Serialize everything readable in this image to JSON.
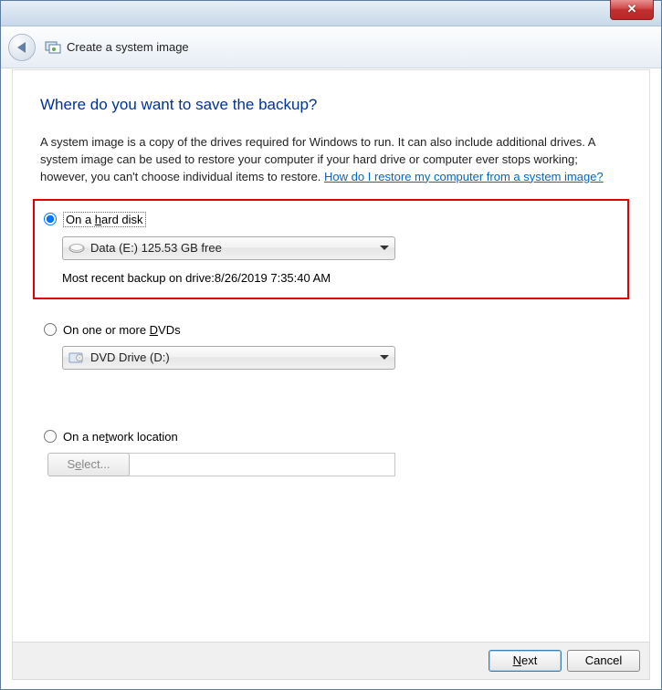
{
  "window": {
    "close_symbol": "✕"
  },
  "header": {
    "title": "Create a system image"
  },
  "main": {
    "heading": "Where do you want to save the backup?",
    "description_part1": "A system image is a copy of the drives required for Windows to run. It can also include additional drives. A system image can be used to restore your computer if your hard drive or computer ever stops working; however, you can't choose individual items to restore. ",
    "help_link": "How do I restore my computer from a system image?"
  },
  "options": {
    "hard_disk": {
      "label_pre": "On a ",
      "label_ul": "h",
      "label_post": "ard disk",
      "selected": true,
      "combo_text": "Data (E:)  125.53 GB free",
      "backup_info": "Most recent backup on drive:8/26/2019 7:35:40 AM"
    },
    "dvd": {
      "label_pre": "On one or more ",
      "label_ul": "D",
      "label_post": "VDs",
      "selected": false,
      "combo_text": "DVD Drive (D:)"
    },
    "network": {
      "label_pre": "On a ne",
      "label_ul": "t",
      "label_post": "work location",
      "selected": false,
      "input_value": "",
      "select_btn_pre": "S",
      "select_btn_ul": "e",
      "select_btn_post": "lect..."
    }
  },
  "footer": {
    "next_pre": "",
    "next_ul": "N",
    "next_post": "ext",
    "cancel": "Cancel"
  }
}
